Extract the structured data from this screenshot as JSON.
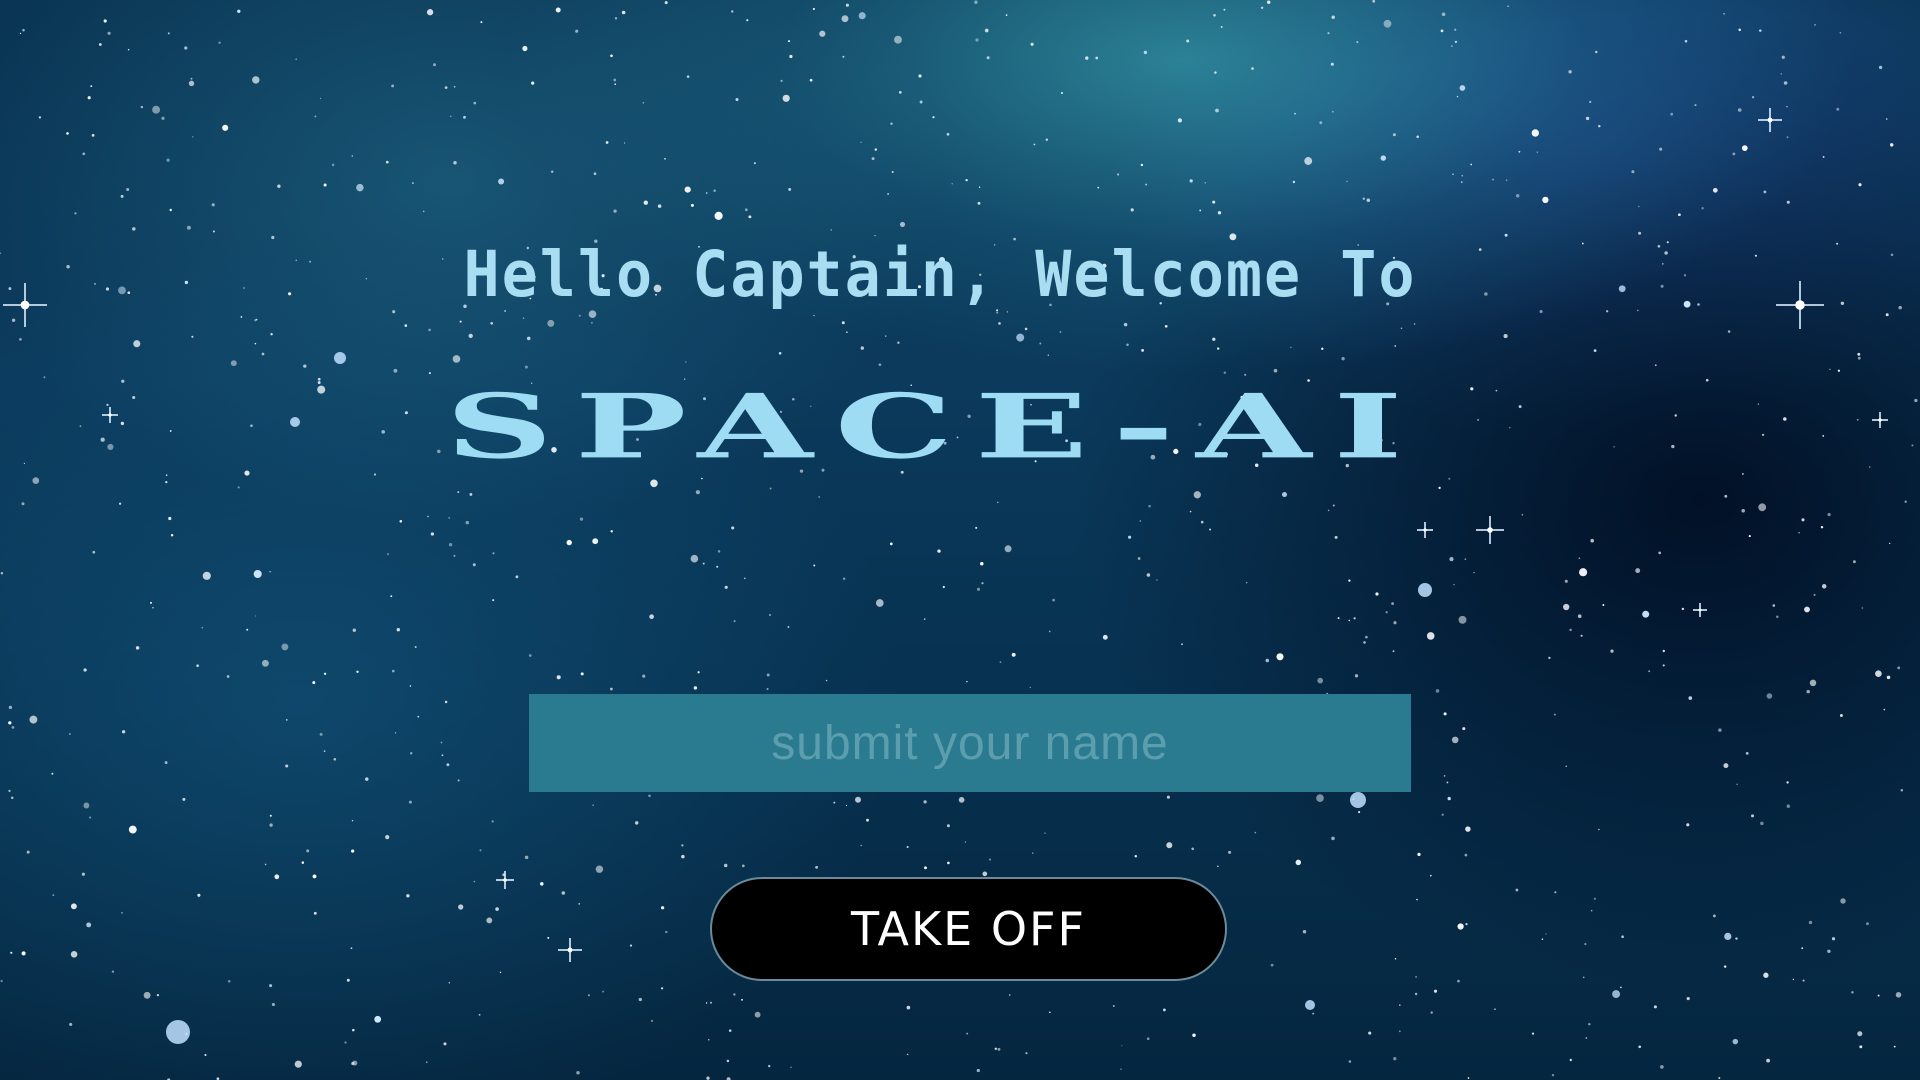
{
  "welcome": {
    "greeting": "Hello Captain, Welcome To",
    "title": "SPACE-AI"
  },
  "form": {
    "name_placeholder": "submit your name",
    "name_value": "",
    "submit_label": "TAKE OFF"
  },
  "colors": {
    "text_accent": "#a9ddf2",
    "input_background": "#2a7b8f",
    "button_background": "#000000",
    "button_text": "#ffffff"
  }
}
